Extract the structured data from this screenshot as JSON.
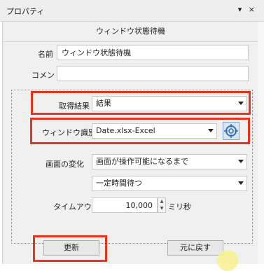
{
  "window": {
    "title": "プロパティ",
    "controls": "▾ ×",
    "subtitle": "ウィンドウ状態待機"
  },
  "fields": {
    "name_label": "名前",
    "name_value": "ウィンドウ状態待機",
    "comment_label": "コメント",
    "comment_value": "",
    "result_label": "取得結果",
    "result_value": "結果",
    "window_id_label": "ウィンドウ識別名",
    "window_id_value": "Date.xlsx-Excel",
    "screen_change_label": "画面の変化",
    "screen_change_value": "画面が操作可能になるまで",
    "wait_mode_value": "一定時間待つ",
    "timeout_label": "タイムアウト",
    "timeout_value": "10,000",
    "timeout_unit": "ミリ秒"
  },
  "buttons": {
    "update": "更新",
    "revert": "元に戻す"
  },
  "colors": {
    "highlight": "#e8341c",
    "accent": "#2f6db3"
  },
  "icons": {
    "target": "crosshair-target-icon"
  }
}
